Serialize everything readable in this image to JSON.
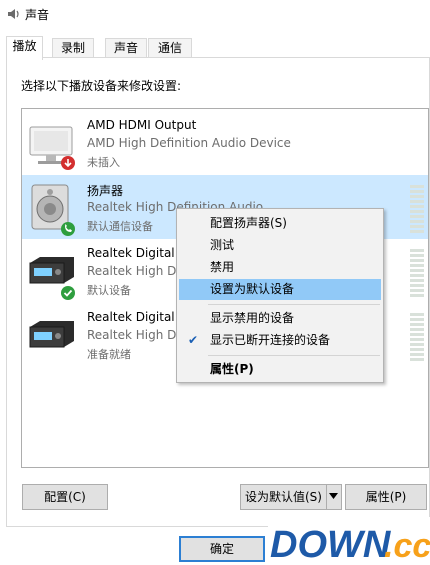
{
  "window": {
    "title": "声音"
  },
  "tabs": [
    {
      "label": "播放"
    },
    {
      "label": "录制"
    },
    {
      "label": "声音"
    },
    {
      "label": "通信"
    }
  ],
  "instruction": "选择以下播放设备来修改设置:",
  "devices": [
    {
      "name": "AMD HDMI Output",
      "driver": "AMD High Definition Audio Device",
      "status": "未插入",
      "icon": "monitor-icon",
      "badge": "unplugged-badge"
    },
    {
      "name": "扬声器",
      "driver": "Realtek High Definition Audio",
      "status": "默认通信设备",
      "icon": "speaker-icon",
      "badge": "phone-badge"
    },
    {
      "name": "Realtek Digital",
      "driver": "Realtek High D",
      "status": "默认设备",
      "icon": "digital-receiver-icon",
      "badge": "checkmark-badge"
    },
    {
      "name": "Realtek Digital",
      "driver": "Realtek High D",
      "status": "准备就绪",
      "icon": "digital-receiver-icon",
      "badge": ""
    }
  ],
  "context_menu": {
    "items": [
      {
        "label": "配置扬声器(S)"
      },
      {
        "label": "测试"
      },
      {
        "label": "禁用"
      },
      {
        "label": "设置为默认设备"
      },
      {
        "label": "显示禁用的设备"
      },
      {
        "label": "显示已断开连接的设备"
      },
      {
        "label": "属性(P)"
      }
    ]
  },
  "buttons": {
    "configure": "配置(C)",
    "set_default": "设为默认值(S)",
    "properties": "属性(P)",
    "ok": "确定"
  },
  "watermark": {
    "text": "DOWN",
    "suffix": ".cc"
  },
  "colors": {
    "selection": "#cce8ff",
    "menu_highlight": "#91c9f7",
    "default_button_border": "#2c7fd3",
    "watermark_blue": "#1e5aa8",
    "watermark_orange": "#f7a11a"
  }
}
